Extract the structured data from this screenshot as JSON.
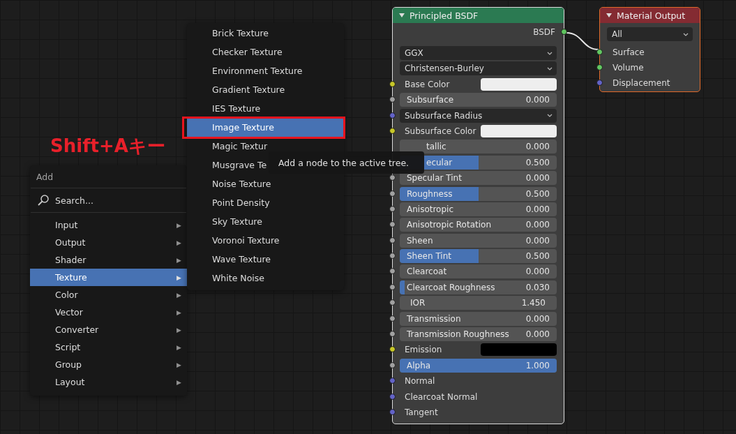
{
  "annotation": {
    "text": "Shift+Aキー"
  },
  "add_menu": {
    "title": "Add",
    "search": "Search...",
    "items": [
      {
        "label": "Input",
        "arrow": "▶",
        "selected": false
      },
      {
        "label": "Output",
        "arrow": "▶",
        "selected": false
      },
      {
        "label": "Shader",
        "arrow": "▶",
        "selected": false
      },
      {
        "label": "Texture",
        "arrow": "▶",
        "selected": true
      },
      {
        "label": "Color",
        "arrow": "▶",
        "selected": false
      },
      {
        "label": "Vector",
        "arrow": "▶",
        "selected": false
      },
      {
        "label": "Converter",
        "arrow": "▶",
        "selected": false
      },
      {
        "label": "Script",
        "arrow": "▶",
        "selected": false
      },
      {
        "label": "Group",
        "arrow": "▶",
        "selected": false
      },
      {
        "label": "Layout",
        "arrow": "▶",
        "selected": false
      }
    ]
  },
  "texture_submenu": {
    "items": [
      {
        "label": "Brick Texture",
        "selected": false
      },
      {
        "label": "Checker Texture",
        "selected": false
      },
      {
        "label": "Environment Texture",
        "selected": false
      },
      {
        "label": "Gradient Texture",
        "selected": false
      },
      {
        "label": "IES Texture",
        "selected": false
      },
      {
        "label": "Image Texture",
        "selected": true
      },
      {
        "label": "Magic Textur",
        "selected": false
      },
      {
        "label": "Musgrave Te",
        "selected": false
      },
      {
        "label": "Noise Texture",
        "selected": false
      },
      {
        "label": "Point Density",
        "selected": false
      },
      {
        "label": "Sky Texture",
        "selected": false
      },
      {
        "label": "Voronoi Texture",
        "selected": false
      },
      {
        "label": "Wave Texture",
        "selected": false
      },
      {
        "label": "White Noise",
        "selected": false
      }
    ]
  },
  "tooltip": {
    "text": "Add a node to the active tree."
  },
  "principled_node": {
    "title": "Principled BSDF",
    "output": {
      "label": "BSDF",
      "color": "#5fc65f"
    },
    "rows": [
      {
        "kind": "enum",
        "label": "GGX"
      },
      {
        "kind": "enum",
        "label": "Christensen-Burley"
      },
      {
        "kind": "color",
        "label": "Base Color",
        "color": "#c7c729",
        "swatch": {
          "color": "#eeeeee"
        }
      },
      {
        "kind": "slider",
        "label": "Subsurface",
        "value": "0.000",
        "level": 0,
        "color": "#a1a1a1"
      },
      {
        "kind": "enum",
        "label": "Subsurface Radius",
        "color": "#6363c7"
      },
      {
        "kind": "color",
        "label": "Subsurface Color",
        "color": "#c7c729",
        "swatch": {
          "color": "#eeeeee"
        }
      },
      {
        "kind": "slider",
        "label": "tallic",
        "value": "0.000",
        "covered": true
      },
      {
        "kind": "slider",
        "label": "ecular",
        "value": "0.500",
        "level": 0.5,
        "covered": true
      },
      {
        "kind": "slider",
        "label": "Specular Tint",
        "value": "0.000",
        "level": 0,
        "color": "#a1a1a1"
      },
      {
        "kind": "slider",
        "label": "Roughness",
        "value": "0.500",
        "level": 0.5,
        "color": "#a1a1a1"
      },
      {
        "kind": "slider",
        "label": "Anisotropic",
        "value": "0.000",
        "level": 0,
        "color": "#a1a1a1"
      },
      {
        "kind": "slider",
        "label": "Anisotropic Rotation",
        "value": "0.000",
        "level": 0,
        "color": "#a1a1a1"
      },
      {
        "kind": "slider",
        "label": "Sheen",
        "value": "0.000",
        "level": 0,
        "color": "#a1a1a1"
      },
      {
        "kind": "slider",
        "label": "Sheen Tint",
        "value": "0.500",
        "level": 0.5,
        "color": "#a1a1a1"
      },
      {
        "kind": "slider",
        "label": "Clearcoat",
        "value": "0.000",
        "level": 0,
        "color": "#a1a1a1"
      },
      {
        "kind": "slider",
        "label": "Clearcoat Roughness",
        "value": "0.030",
        "level": 0.03,
        "color": "#a1a1a1"
      },
      {
        "kind": "number",
        "label": "IOR",
        "value": "1.450",
        "color": "#a1a1a1"
      },
      {
        "kind": "slider",
        "label": "Transmission",
        "value": "0.000",
        "level": 0,
        "color": "#a1a1a1"
      },
      {
        "kind": "slider",
        "label": "Transmission Roughness",
        "value": "0.000",
        "level": 0,
        "color": "#a1a1a1"
      },
      {
        "kind": "color",
        "label": "Emission",
        "color": "#c7c729",
        "swatch": {
          "color": "#000000"
        }
      },
      {
        "kind": "slider",
        "label": "Alpha",
        "value": "1.000",
        "level": 1,
        "color": "#a1a1a1"
      },
      {
        "kind": "socket",
        "label": "Normal",
        "color": "#6363c7"
      },
      {
        "kind": "socket",
        "label": "Clearcoat Normal",
        "color": "#6363c7"
      },
      {
        "kind": "socket",
        "label": "Tangent",
        "color": "#6363c7"
      }
    ]
  },
  "material_output_node": {
    "title": "Material Output",
    "target": "All",
    "inputs": [
      {
        "label": "Surface",
        "color": "#63c763"
      },
      {
        "label": "Volume",
        "color": "#63c763"
      },
      {
        "label": "Displacement",
        "color": "#6363c7"
      }
    ]
  }
}
